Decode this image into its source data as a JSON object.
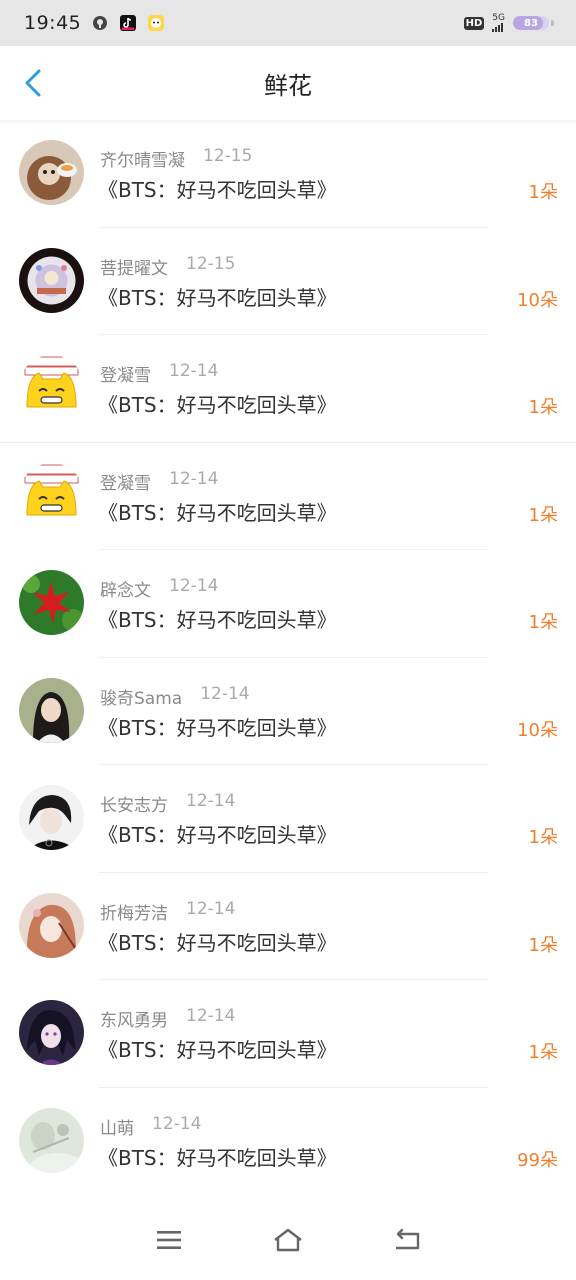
{
  "status_bar": {
    "time": "19:45",
    "network": "5G",
    "hd": "HD",
    "battery": "83",
    "battery_level": 0.83
  },
  "header": {
    "title": "鲜花",
    "back_icon": "chevron-left-icon"
  },
  "items": [
    {
      "user": "齐尔晴雪凝",
      "date": "12-15",
      "book": "《BTS：好马不吃回头草》",
      "count": "1朵"
    },
    {
      "user": "菩提曜文",
      "date": "12-15",
      "book": "《BTS：好马不吃回头草》",
      "count": "10朵"
    },
    {
      "user": "登凝雪",
      "date": "12-14",
      "book": "《BTS：好马不吃回头草》",
      "count": "1朵"
    },
    {
      "user": "登凝雪",
      "date": "12-14",
      "book": "《BTS：好马不吃回头草》",
      "count": "1朵"
    },
    {
      "user": "辟念文",
      "date": "12-14",
      "book": "《BTS：好马不吃回头草》",
      "count": "1朵"
    },
    {
      "user": "骏奇Sama",
      "date": "12-14",
      "book": "《BTS：好马不吃回头草》",
      "count": "10朵"
    },
    {
      "user": "长安志方",
      "date": "12-14",
      "book": "《BTS：好马不吃回头草》",
      "count": "1朵"
    },
    {
      "user": "折梅芳洁",
      "date": "12-14",
      "book": "《BTS：好马不吃回头草》",
      "count": "1朵"
    },
    {
      "user": "东风勇男",
      "date": "12-14",
      "book": "《BTS：好马不吃回头草》",
      "count": "1朵"
    },
    {
      "user": "山萌",
      "date": "12-14",
      "book": "《BTS：好马不吃回头草》",
      "count": "99朵"
    }
  ],
  "navbar": {
    "menu_icon": "menu-icon",
    "home_icon": "home-icon",
    "back_icon": "back-icon"
  },
  "colors": {
    "accent": "#2f9ae8",
    "count": "#f07f2c"
  }
}
